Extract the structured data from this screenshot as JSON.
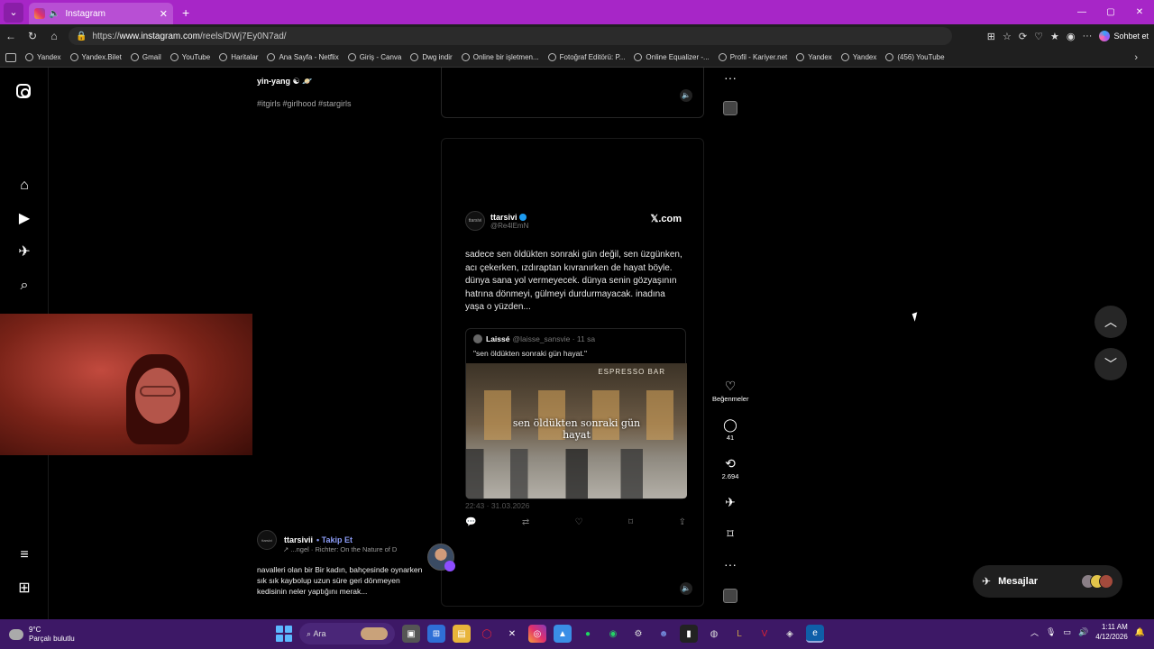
{
  "browser": {
    "tab_title": "Instagram",
    "url_prefix": "https://",
    "url_host": "www.instagram.com",
    "url_path": "/reels/DWj7Ey0N7ad/",
    "copilot_label": "Sohbet et",
    "bookmarks": [
      "Yandex",
      "Yandex.Bilet",
      "Gmail",
      "YouTube",
      "Haritalar",
      "Ana Sayfa - Netflix",
      "Giriş - Canva",
      "Dwg indir",
      "Online bir işletmen...",
      "Fotoğraf Editörü: P...",
      "Online Equalizer -...",
      "Profil - Kariyer.net",
      "Yandex",
      "Yandex",
      "(456) YouTube"
    ]
  },
  "prev_reel": {
    "caption_name": "yin-yang",
    "caption_emoji": "☯ 🪐",
    "tags": "#itgirls #girlhood #stargirls"
  },
  "reel": {
    "tweet": {
      "avatar_text": "ttarsivi",
      "name": "ttarsivi",
      "handle": "@Re4lEmN",
      "source": "𝕏.com",
      "text": "sadece sen öldükten sonraki gün değil, sen üzgünken, acı çekerken, ızdıraptan kıvranırken de hayat böyle. dünya sana yol vermeyecek. dünya senin gözyaşının hatrına dönmeyi, gülmeyi durdurmayacak. inadına yaşa o yüzden...",
      "quote_name": "Laissé",
      "quote_meta": "@laisse_sansvie · 11 sa",
      "quote_text": "\"sen öldükten sonraki gün hayat.\"",
      "image_sign": "ESPRESSO BAR",
      "image_overlay_1": "sen öldükten sonraki gün",
      "image_overlay_2": "hayat",
      "date": "22:43 · 31.03.2026"
    },
    "author": "ttarsivii",
    "follow_label": "Takip Et",
    "audio": "↗ ...ngel · Richter: On the Nature of D",
    "description": "navalleri olan bir Bir kadın, bahçesinde oynarken sık sık kaybolup uzun süre geri dönmeyen kedisinin neler yaptığını merak..."
  },
  "rail": {
    "like_label": "Beğenmeler",
    "comments": "41",
    "reposts": "2.694"
  },
  "messages_label": "Mesajlar",
  "taskbar": {
    "temp": "9°C",
    "weather": "Parçalı bulutlu",
    "search_label": "Ara",
    "time": "1:11 AM",
    "date": "4/12/2026"
  },
  "colors": {
    "titlebar": "#a726c7",
    "taskbar": "#3d1866",
    "follow": "#8b9bf5"
  }
}
